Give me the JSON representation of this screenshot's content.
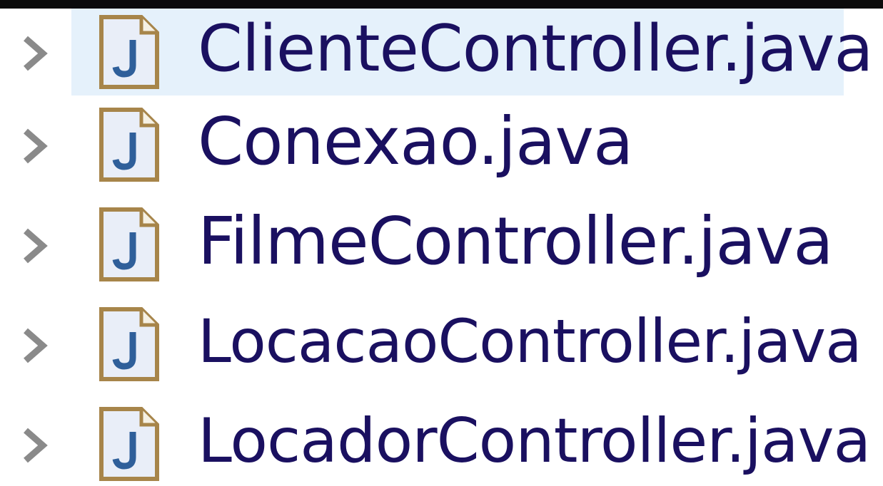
{
  "project_explorer": {
    "items": [
      {
        "label": "ClienteController.java",
        "icon": "java-file-icon",
        "selected": true
      },
      {
        "label": "Conexao.java",
        "icon": "java-file-icon",
        "selected": false
      },
      {
        "label": "FilmeController.java",
        "icon": "java-file-icon",
        "selected": false
      },
      {
        "label": "LocacaoController.java",
        "icon": "java-file-icon",
        "selected": false
      },
      {
        "label": "LocadorController.java",
        "icon": "java-file-icon",
        "selected": false
      }
    ]
  },
  "colors": {
    "selection": "#e5f1fb",
    "text": "#1a1060",
    "chevron": "#8a8a8a",
    "icon_border": "#a7854a",
    "icon_fill": "#e9eef8",
    "icon_glyph": "#2f5f9a"
  }
}
